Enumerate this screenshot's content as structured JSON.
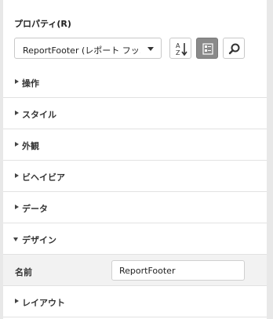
{
  "panel": {
    "title": "プロパティ(R)",
    "selector_value": "ReportFooter (レポート フッ...",
    "toolbar": {
      "sort_icon": "sort-alphabetical-icon",
      "category_icon": "categorized-view-icon",
      "search_icon": "search-icon"
    },
    "categories": [
      {
        "label": "操作",
        "expanded": false
      },
      {
        "label": "スタイル",
        "expanded": false
      },
      {
        "label": "外観",
        "expanded": false
      },
      {
        "label": "ビヘイビア",
        "expanded": false
      },
      {
        "label": "データ",
        "expanded": false
      },
      {
        "label": "デザイン",
        "expanded": true
      },
      {
        "label": "レイアウト",
        "expanded": false
      }
    ],
    "design_property": {
      "name": "名前",
      "value": "ReportFooter"
    }
  }
}
